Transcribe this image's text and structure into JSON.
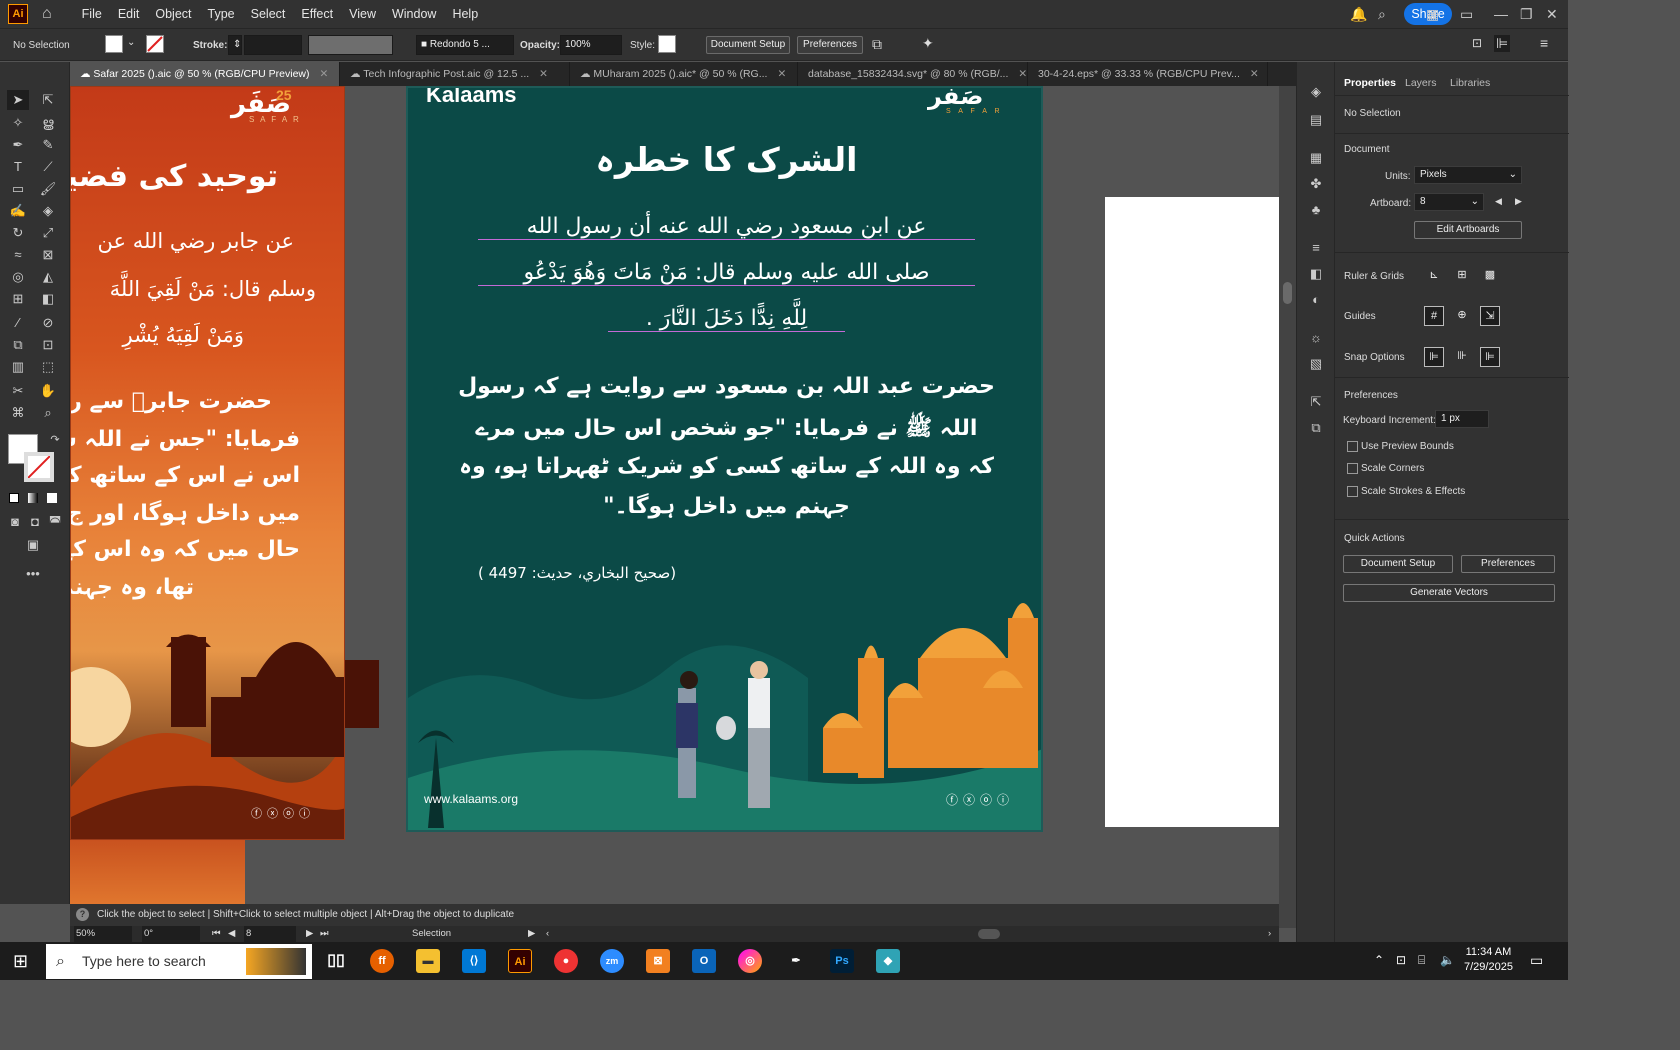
{
  "app": {
    "logo": "Ai",
    "share_label": "Share"
  },
  "menu": [
    "File",
    "Edit",
    "Object",
    "Type",
    "Select",
    "Effect",
    "View",
    "Window",
    "Help"
  ],
  "control": {
    "selection": "No Selection",
    "stroke_label": "Stroke:",
    "font_value": "Redondo 5 ...",
    "opacity_label": "Opacity:",
    "opacity_value": "100%",
    "style_label": "Style:",
    "document_setup": "Document Setup",
    "preferences": "Preferences"
  },
  "tabs": [
    {
      "label": "Safar 2025 ().aic @ 50 % (RGB/CPU Preview)",
      "active": true
    },
    {
      "label": "Tech Infographic Post.aic @ 12.5 ...",
      "active": false
    },
    {
      "label": "MUharam 2025 ().aic* @ 50 % (RG...",
      "active": false
    },
    {
      "label": "database_15832434.svg* @ 80 % (RGB/...",
      "active": false
    },
    {
      "label": "30-4-24.eps* @ 33.33 % (RGB/CPU Prev...",
      "active": false
    }
  ],
  "panel": {
    "tabs": [
      "Properties",
      "Layers",
      "Libraries"
    ],
    "selection": "No Selection",
    "document_title": "Document",
    "units_label": "Units:",
    "units_value": "Pixels",
    "artboard_label": "Artboard:",
    "artboard_value": "8",
    "edit_artboards": "Edit Artboards",
    "rulers_grids": "Ruler & Grids",
    "guides": "Guides",
    "snap_options": "Snap Options",
    "preferences_title": "Preferences",
    "keyboard_increment_label": "Keyboard Increment:",
    "keyboard_increment_value": "1 px",
    "checkboxes": [
      "Use Preview Bounds",
      "Scale Corners",
      "Scale Strokes & Effects"
    ],
    "quick_actions": "Quick Actions",
    "qa_document_setup": "Document Setup",
    "qa_preferences": "Preferences",
    "generate_vectors": "Generate Vectors"
  },
  "status": {
    "hint": "Click the object to select  |  Shift+Click to select multiple object  |  Alt+Drag the object to duplicate",
    "zoom": "50%",
    "rotation": "0°",
    "artboard": "8",
    "tool": "Selection"
  },
  "left_artboard": {
    "brand": "صَفَر",
    "brand_sub": "S A F A R",
    "brand_num": "25",
    "heading": "توحید کی فضیل",
    "arabic": [
      "عن جابر رضي الله عن",
      "وسلم قال: مَنْ لَقِيَ اللَّهَ",
      "وَمَنْ لَقِيَهُ يُشْرِ"
    ],
    "urdu": [
      "حضرت جابرؓ سے رو",
      "فرمایا: \"جس نے اللہ سے",
      "اس نے اس کے ساتھ کس",
      "میں داخل ہوگا، اور ج",
      "حال میں کہ وہ اس کے",
      "تھا، وہ جہنم"
    ]
  },
  "main_artboard": {
    "brand_left": "Kalaams",
    "brand_right": "صَفَر",
    "brand_right_sub": "S A F A R",
    "title": "الشرک کا خطرہ",
    "arabic": [
      "عن ابن مسعود رضي الله عنه أن رسول الله",
      "صلى الله عليه وسلم قال: مَنْ مَاتَ وَهُوَ يَدْعُو",
      "لِلَّهِ نِدًّا دَخَلَ النَّارَ ."
    ],
    "urdu": [
      "حضرت عبد اللہ بن مسعود سے روایت ہے کہ رسول",
      "اللہ ﷺ نے فرمایا: \"جو شخص اس حال میں مرے",
      "کہ وہ اللہ کے ساتھ کسی کو شریک ٹھہراتا ہو، وہ",
      "جہنم میں داخل ہوگا۔\""
    ],
    "reference": "(صحيح البخاري، حديث: 4497 )",
    "website": "www.kalaams.org"
  },
  "taskbar": {
    "search_placeholder": "Type here to search",
    "time": "11:34 AM",
    "date": "7/29/2025"
  },
  "colors": {
    "accent": "#1473e6",
    "artboard_teal": "#0a4a48",
    "artboard_orange": "#d9531e",
    "mosque_orange": "#f2a13a"
  }
}
